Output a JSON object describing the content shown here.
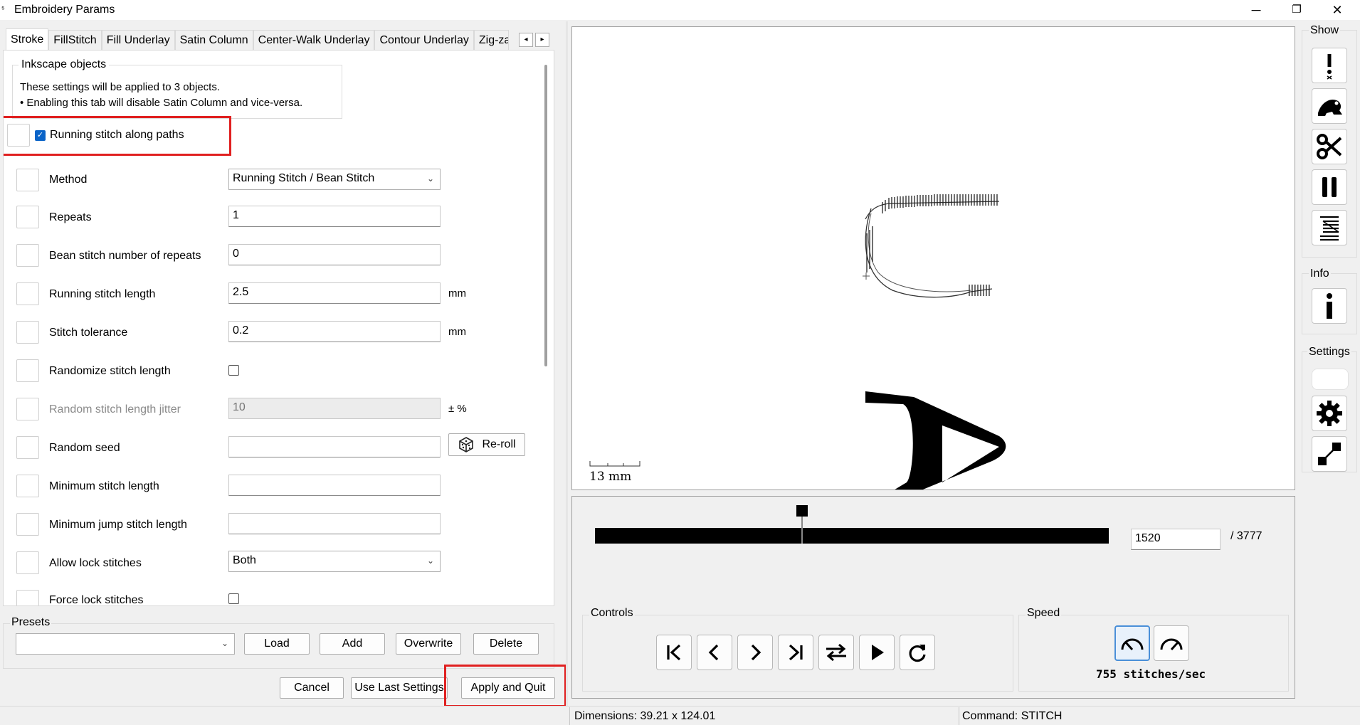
{
  "window": {
    "title": "Embroidery Params",
    "minimize": "─",
    "maximize": "❐",
    "close": "✕"
  },
  "tabs": [
    "Stroke",
    "FillStitch",
    "Fill Underlay",
    "Satin Column",
    "Center-Walk Underlay",
    "Contour Underlay",
    "Zig-za"
  ],
  "tab_scroll": {
    "left": "◂",
    "right": "▸"
  },
  "inkscape": {
    "legend": "Inkscape objects",
    "line1": "These settings will be applied to 3 objects.",
    "line2": "• Enabling this tab will disable Satin Column and vice-versa."
  },
  "enable": {
    "label": "Running stitch along paths",
    "checked": true
  },
  "params": {
    "method": {
      "label": "Method",
      "value": "Running Stitch / Bean Stitch"
    },
    "repeats": {
      "label": "Repeats",
      "value": "1"
    },
    "bean": {
      "label": "Bean stitch number of repeats",
      "value": "0"
    },
    "run_len": {
      "label": "Running stitch length",
      "value": "2.5",
      "unit": "mm"
    },
    "tolerance": {
      "label": "Stitch tolerance",
      "value": "0.2",
      "unit": "mm"
    },
    "randomize": {
      "label": "Randomize stitch length"
    },
    "jitter": {
      "label": "Random stitch length jitter",
      "value": "10",
      "unit": "± %"
    },
    "seed": {
      "label": "Random seed",
      "value": "",
      "button": "Re-roll"
    },
    "min_len": {
      "label": "Minimum stitch length",
      "value": ""
    },
    "min_jump": {
      "label": "Minimum jump stitch length",
      "value": ""
    },
    "lock": {
      "label": "Allow lock stitches",
      "value": "Both"
    },
    "force_lock": {
      "label": "Force lock stitches"
    }
  },
  "presets": {
    "legend": "Presets",
    "value": "",
    "load": "Load",
    "add": "Add",
    "overwrite": "Overwrite",
    "delete": "Delete"
  },
  "bottom_buttons": {
    "cancel": "Cancel",
    "use_last": "Use Last Settings",
    "apply": "Apply and Quit"
  },
  "preview": {
    "scale_label": "13 mm",
    "current_stitch": "1520",
    "total_stitches": "/ 3777",
    "slider_position": 0.4024
  },
  "controls": {
    "legend": "Controls",
    "buttons": [
      "first-stitch",
      "previous-stitch",
      "next-stitch",
      "last-stitch",
      "swap-direction",
      "play",
      "restart"
    ]
  },
  "speed": {
    "legend": "Speed",
    "text": "755 stitches/sec"
  },
  "sidebar": {
    "show_label": "Show",
    "info_label": "Info",
    "settings_label": "Settings"
  },
  "status": {
    "dimensions": "Dimensions: 39.21 x 124.01",
    "command": "Command: STITCH"
  },
  "colors": {
    "checkbox_accent": "#0a64c8",
    "highlight": "#e02020"
  }
}
